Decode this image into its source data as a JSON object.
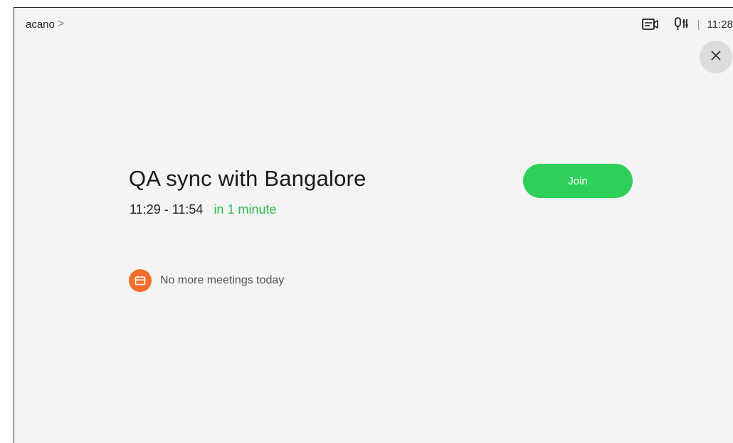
{
  "header": {
    "device_name": "acano",
    "chevron": ">",
    "separator": "|",
    "clock": "11:28",
    "icons": [
      "self-view-camera-icon",
      "microphone-settings-icon"
    ]
  },
  "close": {
    "icon": "close-icon"
  },
  "meeting": {
    "title": "QA sync with Bangalore",
    "time_range": "11:29 - 11:54",
    "relative_start": "in 1 minute",
    "join_label": "Join"
  },
  "agenda": {
    "icon": "calendar-icon",
    "empty_text": "No more meetings today"
  },
  "colors": {
    "join": "#2fd05a",
    "relative_time": "#2fb84e",
    "calendar_badge": "#f36e2a",
    "background": "#f4f4f4"
  }
}
